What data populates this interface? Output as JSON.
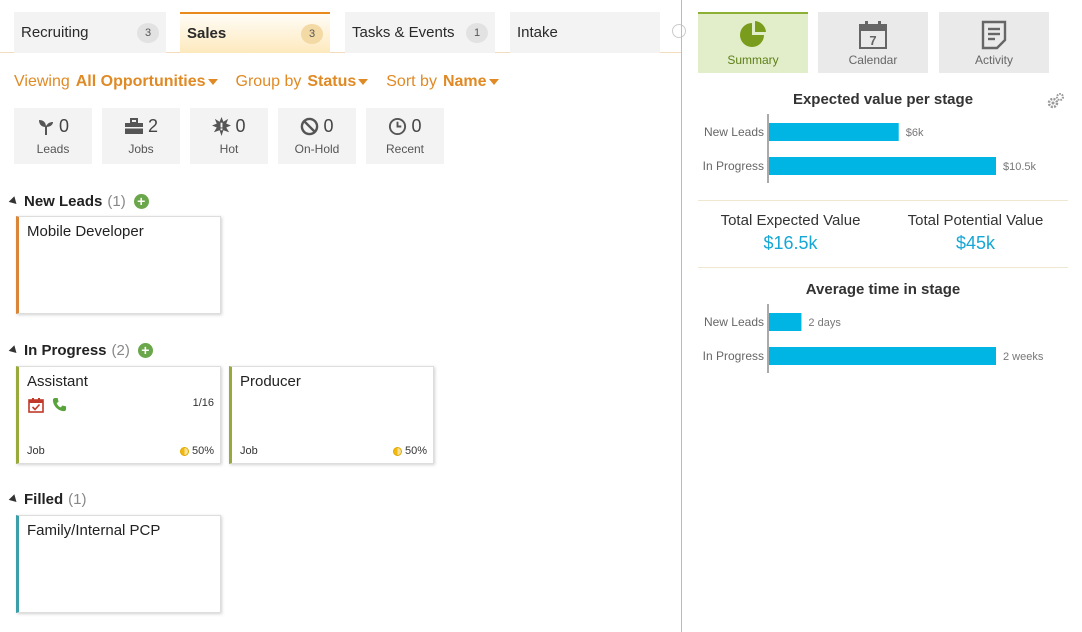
{
  "tabs": [
    {
      "label": "Recruiting",
      "count": "3"
    },
    {
      "label": "Sales",
      "count": "3"
    },
    {
      "label": "Tasks & Events",
      "count": "1"
    },
    {
      "label": "Intake",
      "count": ""
    }
  ],
  "viewbar": {
    "viewing_label": "Viewing",
    "viewing_value": "All Opportunities",
    "group_label": "Group by",
    "group_value": "Status",
    "sort_label": "Sort by",
    "sort_value": "Name"
  },
  "filters": [
    {
      "label": "Leads",
      "count": "0",
      "icon": "sprout-icon"
    },
    {
      "label": "Jobs",
      "count": "2",
      "icon": "briefcase-icon"
    },
    {
      "label": "Hot",
      "count": "0",
      "icon": "burst-icon"
    },
    {
      "label": "On-Hold",
      "count": "0",
      "icon": "ban-icon"
    },
    {
      "label": "Recent",
      "count": "0",
      "icon": "clock-icon"
    }
  ],
  "groups": [
    {
      "name": "New Leads",
      "count": "(1)",
      "cards": [
        {
          "title": "Mobile Developer",
          "color": "#d9853a"
        }
      ]
    },
    {
      "name": "In Progress",
      "count": "(2)",
      "cards": [
        {
          "title": "Assistant",
          "ratio": "1/16",
          "kind": "Job",
          "percent": "50%",
          "color": "#98aa3c"
        },
        {
          "title": "Producer",
          "kind": "Job",
          "percent": "50%",
          "color": "#98aa3c"
        }
      ]
    },
    {
      "name": "Filled",
      "count": "(1)",
      "cards": [
        {
          "title": "Family/Internal PCP",
          "color": "#3c9ea8"
        }
      ]
    }
  ],
  "right_tabs": [
    {
      "label": "Summary",
      "icon": "pie-chart-icon"
    },
    {
      "label": "Calendar",
      "icon": "calendar-icon",
      "day": "7"
    },
    {
      "label": "Activity",
      "icon": "document-icon"
    }
  ],
  "summary": {
    "total_expected_label": "Total Expected Value",
    "total_expected_value": "$16.5k",
    "total_potential_label": "Total Potential Value",
    "total_potential_value": "$45k"
  },
  "chart_data": [
    {
      "type": "bar",
      "title": "Expected value per stage",
      "categories": [
        "New Leads",
        "In Progress"
      ],
      "values": [
        6,
        10.5
      ],
      "value_labels": [
        "$6k",
        "$10.5k"
      ],
      "unit": "k$",
      "xlim": [
        0,
        10.5
      ],
      "orientation": "horizontal",
      "color": "#00b4e4"
    },
    {
      "type": "bar",
      "title": "Average time in stage",
      "categories": [
        "New Leads",
        "In Progress"
      ],
      "values": [
        2,
        14
      ],
      "value_labels": [
        "2 days",
        "2 weeks"
      ],
      "unit": "days",
      "xlim": [
        0,
        14
      ],
      "orientation": "horizontal",
      "color": "#00b4e4"
    }
  ],
  "colors": {
    "accent": "#e08a25",
    "bar": "#00b4e4",
    "plus": "#6aa64a"
  }
}
